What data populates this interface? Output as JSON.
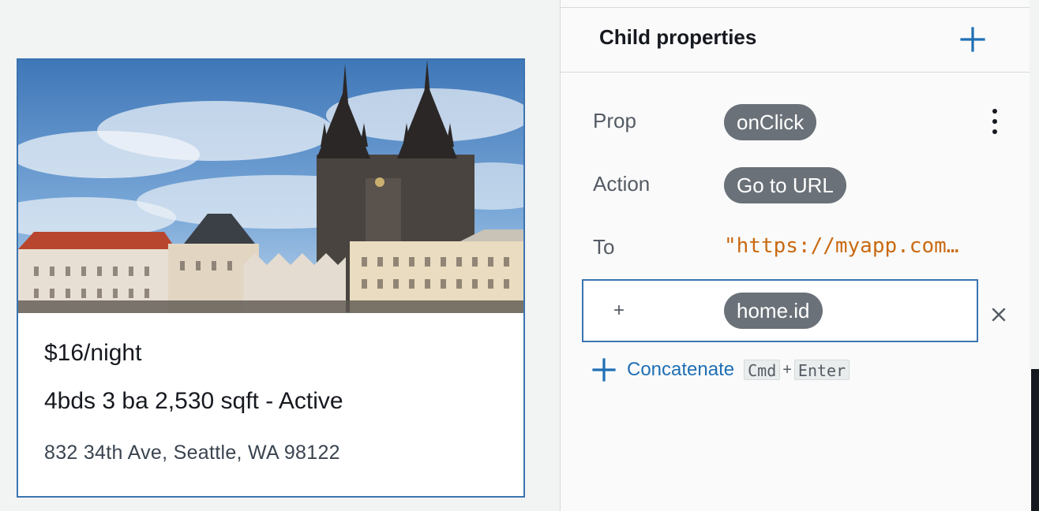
{
  "card": {
    "image_alt": "Prague Old Town Square with Church of Our Lady before Týn",
    "price": "$16/night",
    "specs": "4bds 3 ba 2,530 sqft - Active",
    "address": "832 34th Ave, Seattle, WA 98122"
  },
  "panel": {
    "title": "Child properties",
    "add_icon": "plus-icon",
    "rows": {
      "prop_label": "Prop",
      "prop_value": "onClick",
      "action_label": "Action",
      "action_value": "Go to URL",
      "to_label": "To",
      "to_value": "\"https://myapp.com…"
    },
    "concat_row": {
      "operator": "+",
      "value": "home.id"
    },
    "concatenate": {
      "label": "Concatenate",
      "key1": "Cmd",
      "key_plus": "+",
      "key2": "Enter"
    }
  },
  "colors": {
    "accent": "#3b74b0",
    "link": "#1f6fb5",
    "pill": "#6b7178",
    "string_literal": "#c96a12"
  }
}
